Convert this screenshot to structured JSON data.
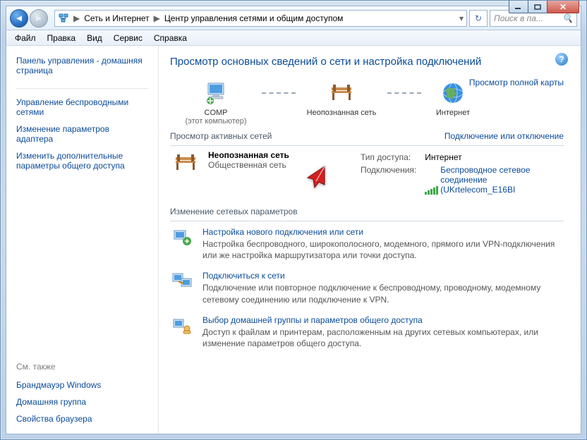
{
  "titlebar": {
    "min": "_",
    "max": "▢",
    "close": "✕"
  },
  "breadcrumb": {
    "b1": "Сеть и Интернет",
    "b2": "Центр управления сетями и общим доступом"
  },
  "search": {
    "placeholder": "Поиск в па..."
  },
  "menu": {
    "file": "Файл",
    "edit": "Правка",
    "view": "Вид",
    "service": "Сервис",
    "help": "Справка"
  },
  "sidebar": {
    "home": "Панель управления - домашняя страница",
    "l1": "Управление беспроводными сетями",
    "l2": "Изменение параметров адаптера",
    "l3": "Изменить дополнительные параметры общего доступа",
    "see_also": "См. также",
    "s1": "Брандмауэр Windows",
    "s2": "Домашняя группа",
    "s3": "Свойства браузера"
  },
  "content": {
    "title": "Просмотр основных сведений о сети и настройка подключений",
    "fullmap": "Просмотр полной карты",
    "node_comp": "COMP",
    "node_comp_sub": "(этот компьютер)",
    "node_unknown": "Неопознанная сеть",
    "node_internet": "Интернет",
    "active_hdr": "Просмотр активных сетей",
    "connect_link": "Подключение или отключение",
    "net_name": "Неопознанная сеть",
    "net_type": "Общественная сеть",
    "prop_access": "Тип доступа:",
    "prop_access_v": "Интернет",
    "prop_conn": "Подключения:",
    "prop_conn_v": "Беспроводное сетевое соединение (UKrtelecom_E16BI",
    "change_hdr": "Изменение сетевых параметров",
    "opt1_t": "Настройка нового подключения или сети",
    "opt1_d": "Настройка беспроводного, широкополосного, модемного, прямого или VPN-подключения или же настройка маршрутизатора или точки доступа.",
    "opt2_t": "Подключиться к сети",
    "opt2_d": "Подключение или повторное подключение к беспроводному, проводному, модемному сетевому соединению или подключение к VPN.",
    "opt3_t": "Выбор домашней группы и параметров общего доступа",
    "opt3_d": "Доступ к файлам и принтерам, расположенным на других сетевых компьютерах, или изменение параметров общего доступа."
  }
}
